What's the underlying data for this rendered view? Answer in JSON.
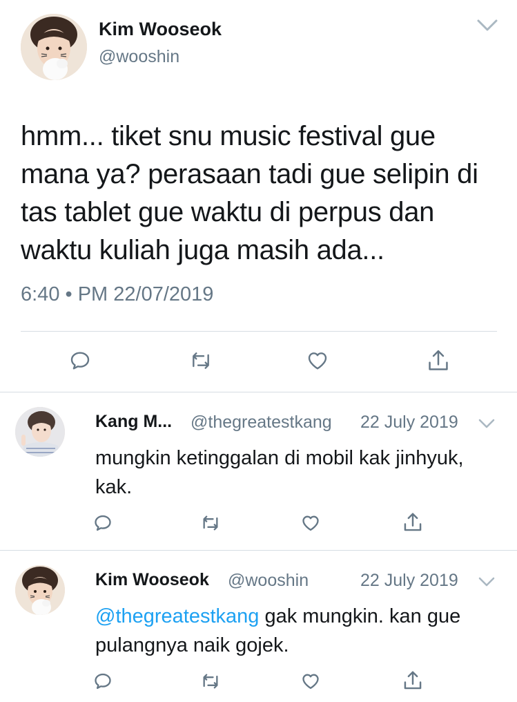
{
  "main_tweet": {
    "author_name": "Kim Wooseok",
    "author_handle": "@wooshin",
    "text": "hmm... tiket snu music festival gue mana ya? perasaan tadi gue selipin di tas tablet gue waktu di perpus dan waktu kuliah juga masih ada...",
    "timestamp": "6:40 • PM 22/07/2019",
    "actions": [
      "reply-icon",
      "retweet-icon",
      "like-icon",
      "share-icon"
    ]
  },
  "replies": [
    {
      "author_name": "Kang M...",
      "author_handle": "@thegreatestkang",
      "date": "22 July 2019",
      "text": "mungkin ketinggalan di mobil kak jinhyuk, kak."
    },
    {
      "author_name": "Kim Wooseok",
      "author_handle": "@wooshin",
      "date": "22 July 2019",
      "mention": "@thegreatestkang",
      "text": " gak mungkin. kan gue pulangnya naik gojek."
    }
  ],
  "colors": {
    "text_primary": "#14171a",
    "text_secondary": "#657786",
    "mention_blue": "#1da1f2",
    "divider": "#d6dde3",
    "icon_gray": "#657786"
  }
}
